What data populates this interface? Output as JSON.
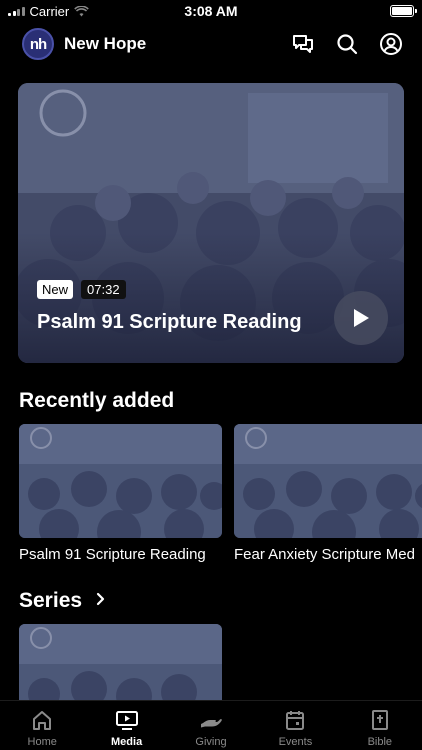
{
  "status_bar": {
    "carrier": "Carrier",
    "time": "3:08 AM"
  },
  "header": {
    "logo_text": "nh",
    "title": "New Hope",
    "icons": [
      "chat-icon",
      "search-icon",
      "profile-icon"
    ]
  },
  "hero": {
    "badge": "New",
    "duration": "07:32",
    "title": "Psalm 91 Scripture Reading",
    "play_icon": "play-icon"
  },
  "recently_added": {
    "heading": "Recently added",
    "items": [
      {
        "title": "Psalm 91 Scripture Reading"
      },
      {
        "title": "Fear Anxiety Scripture Med"
      }
    ]
  },
  "series": {
    "heading": "Series",
    "chevron_icon": "chevron-right-icon"
  },
  "tabs": [
    {
      "label": "Home",
      "icon": "home-icon",
      "active": false
    },
    {
      "label": "Media",
      "icon": "media-icon",
      "active": true
    },
    {
      "label": "Giving",
      "icon": "giving-icon",
      "active": false
    },
    {
      "label": "Events",
      "icon": "calendar-icon",
      "active": false
    },
    {
      "label": "Bible",
      "icon": "bible-icon",
      "active": false
    }
  ],
  "colors": {
    "background": "#000000",
    "logo_bg": "#2a2f75",
    "inactive_tab": "#8a8a8a"
  }
}
